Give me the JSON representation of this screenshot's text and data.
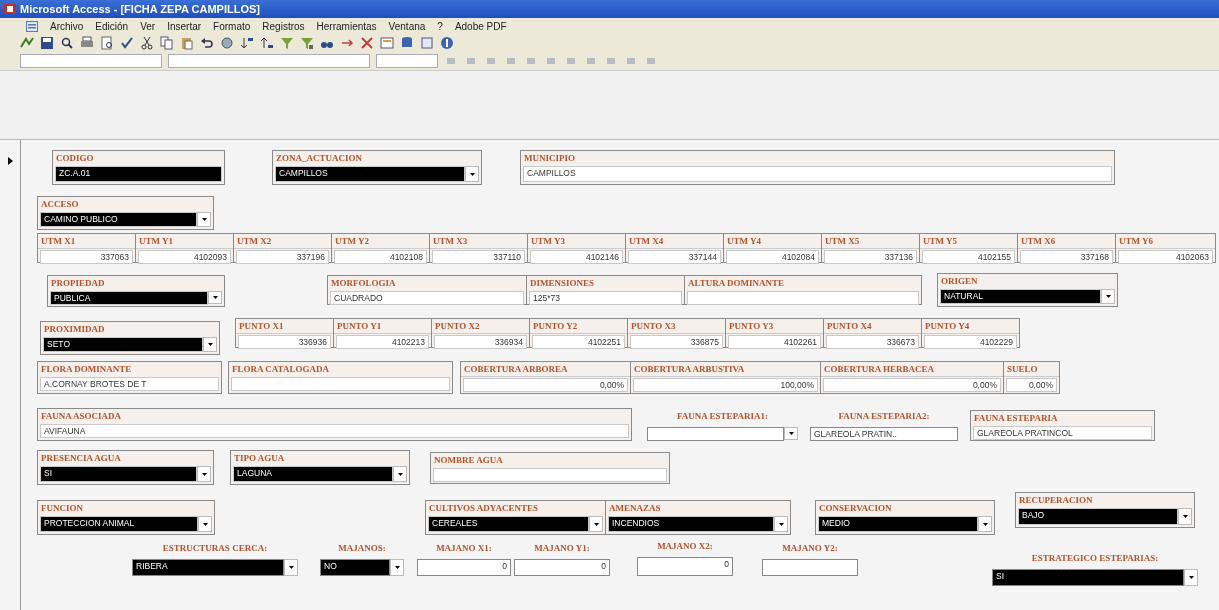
{
  "window": {
    "title": "Microsoft Access - [FICHA ZEPA CAMPILLOS]"
  },
  "menu": [
    "Archivo",
    "Edición",
    "Ver",
    "Insertar",
    "Formato",
    "Registros",
    "Herramientas",
    "Ventana",
    "?",
    "Adobe PDF"
  ],
  "controls": [
    {
      "kind": "text",
      "label": "CODIGO",
      "value": "ZC.A.01",
      "framed": true,
      "highlighted": true
    },
    {
      "kind": "combo",
      "label": "ZONA_ACTUACION",
      "value": "CAMPILLOS",
      "framed": true,
      "highlighted": true
    },
    {
      "kind": "text",
      "label": "MUNICIPIO",
      "value": "CAMPILLOS",
      "framed": true,
      "highlighted": false
    },
    {
      "kind": "combo",
      "label": "ACCESO",
      "value": "CAMINO PUBLICO",
      "framed": true,
      "highlighted": true
    },
    {
      "kind": "cell",
      "label": "UTM X1",
      "value": "337063",
      "framed": true
    },
    {
      "kind": "cell",
      "label": "UTM Y1",
      "value": "4102093",
      "framed": true
    },
    {
      "kind": "cell",
      "label": "UTM X2",
      "value": "337196",
      "framed": true
    },
    {
      "kind": "cell",
      "label": "UTM Y2",
      "value": "4102108",
      "framed": true
    },
    {
      "kind": "cell",
      "label": "UTM X3",
      "value": "337110",
      "framed": true
    },
    {
      "kind": "cell",
      "label": "UTM Y3",
      "value": "4102146",
      "framed": true
    },
    {
      "kind": "cell",
      "label": "UTM X4",
      "value": "337144",
      "framed": true
    },
    {
      "kind": "cell",
      "label": "UTM Y4",
      "value": "4102084",
      "framed": true
    },
    {
      "kind": "cell",
      "label": "UTM X5",
      "value": "337136",
      "framed": true
    },
    {
      "kind": "cell",
      "label": "UTM Y5",
      "value": "4102155",
      "framed": true
    },
    {
      "kind": "cell",
      "label": "UTM X6",
      "value": "337168",
      "framed": true
    },
    {
      "kind": "cell",
      "label": "UTM Y6",
      "value": "4102063",
      "framed": true
    },
    {
      "kind": "combo",
      "label": "PROPIEDAD",
      "value": "PUBLICA",
      "framed": true,
      "highlighted": true
    },
    {
      "kind": "text",
      "label": "MORFOLOGIA",
      "value": "CUADRADO",
      "framed": true,
      "highlighted": false
    },
    {
      "kind": "text",
      "label": "DIMENSIONES",
      "value": "125*73",
      "framed": true,
      "highlighted": false
    },
    {
      "kind": "text",
      "label": "ALTURA DOMINANTE",
      "framed": true,
      "highlighted": false
    },
    {
      "kind": "combo",
      "label": "ORIGEN",
      "value": "NATURAL",
      "framed": true,
      "highlighted": true
    },
    {
      "kind": "combo",
      "label": "PROXIMIDAD",
      "value": "SETO",
      "framed": true,
      "highlighted": true
    },
    {
      "kind": "cell",
      "label": "PUNTO X1",
      "value": "336936",
      "framed": true
    },
    {
      "kind": "cell",
      "label": "PUNTO Y1",
      "value": "4102213",
      "framed": true
    },
    {
      "kind": "cell",
      "label": "PUNTO X2",
      "value": "336934",
      "framed": true
    },
    {
      "kind": "cell",
      "label": "PUNTO Y2",
      "value": "4102251",
      "framed": true
    },
    {
      "kind": "cell",
      "label": "PUNTO X3",
      "value": "336875",
      "framed": true
    },
    {
      "kind": "cell",
      "label": "PUNTO Y3",
      "value": "4102261",
      "framed": true
    },
    {
      "kind": "cell",
      "label": "PUNTO X4",
      "value": "336673",
      "framed": true
    },
    {
      "kind": "cell",
      "label": "PUNTO Y4",
      "value": "4102229",
      "framed": true
    },
    {
      "kind": "text",
      "label": "FLORA DOMINANTE",
      "value": "A.CORNAY BROTES DE T",
      "framed": true,
      "highlighted": false
    },
    {
      "kind": "text",
      "label": "FLORA CATALOGADA",
      "framed": true,
      "highlighted": false
    },
    {
      "kind": "cell",
      "label": "COBERTURA ARBOREA",
      "value": "0,00%",
      "framed": true
    },
    {
      "kind": "cell",
      "label": "COBERTURA ARBUSTIVA",
      "value": "100,00%",
      "framed": true
    },
    {
      "kind": "cell",
      "label": "COBERTURA HERBACEA",
      "value": "0,00%",
      "framed": true
    },
    {
      "kind": "cell",
      "label": "SUELO",
      "value": "0,00%",
      "framed": true
    },
    {
      "kind": "text",
      "label": "FAUNA ASOCIADA",
      "value": "AVIFAUNA",
      "framed": true,
      "highlighted": false
    },
    {
      "kind": "combo",
      "label": "FAUNA ESTEPARIA1:",
      "framed": false,
      "highlighted": false
    },
    {
      "kind": "text",
      "label": "FAUNA ESTEPARIA2:",
      "value": "GLAREOLA PRATIN..",
      "framed": false,
      "highlighted": false
    },
    {
      "kind": "text",
      "label": "FAUNA ESTEPARIA",
      "value": "GLAREOLA PRATINCOL",
      "framed": true,
      "highlighted": false
    },
    {
      "kind": "combo",
      "label": "PRESENCIA AGUA",
      "value": "SI",
      "framed": true,
      "highlighted": true
    },
    {
      "kind": "combo",
      "label": "TIPO AGUA",
      "value": "LAGUNA",
      "framed": true,
      "highlighted": true
    },
    {
      "kind": "text",
      "label": "NOMBRE AGUA",
      "framed": true,
      "highlighted": false
    },
    {
      "kind": "combo",
      "label": "FUNCION",
      "value": "PROTECCION ANIMAL",
      "framed": true,
      "highlighted": true
    },
    {
      "kind": "combo",
      "label": "CULTIVOS ADYACENTES",
      "value": "CEREALES",
      "framed": true,
      "highlighted": true
    },
    {
      "kind": "combo",
      "label": "AMENAZAS",
      "value": "INCENDIOS",
      "framed": true,
      "highlighted": true
    },
    {
      "kind": "combo",
      "label": "CONSERVACION",
      "value": "MEDIO",
      "framed": true,
      "highlighted": true
    },
    {
      "kind": "combo",
      "label": "RECUPERACION",
      "value": "BAJO",
      "framed": true,
      "highlighted": true
    },
    {
      "kind": "combo",
      "label": "ESTRUCTURAS CERCA:",
      "value": "RIBERA",
      "framed": false,
      "highlighted": true
    },
    {
      "kind": "combo",
      "label": "MAJANOS:",
      "value": "NO",
      "framed": false,
      "highlighted": true
    },
    {
      "kind": "cell",
      "label": "MAJANO X1:",
      "value": "0",
      "framed": false
    },
    {
      "kind": "cell",
      "label": "MAJANO Y1:",
      "value": "0",
      "framed": false
    },
    {
      "kind": "cell",
      "label": "MAJANO X2:",
      "value": "0",
      "framed": false
    },
    {
      "kind": "cell",
      "label": "MAJANO Y2:",
      "framed": false
    },
    {
      "kind": "combo",
      "label": "ESTRATEGICO ESTEPARIAS:",
      "value": "SI",
      "framed": false,
      "highlighted": true
    }
  ]
}
